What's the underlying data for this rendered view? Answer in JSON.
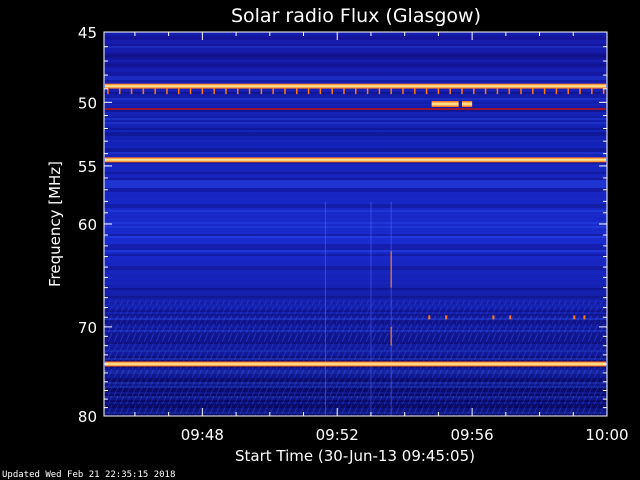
{
  "chart_data": {
    "type": "heatmap",
    "title": "Solar radio Flux (Glasgow)",
    "xlabel": "Start Time (30-Jun-13 09:45:05)",
    "ylabel": "Frequency [MHz]",
    "footer": "Updated Wed Feb 21 22:35:15 2018",
    "x_start_minutes": 45.083,
    "x_end_minutes": 60,
    "x_ticks": [
      {
        "minute": 48,
        "label": "09:48"
      },
      {
        "minute": 52,
        "label": "09:52"
      },
      {
        "minute": 56,
        "label": "09:56"
      },
      {
        "minute": 60,
        "label": "10:00"
      }
    ],
    "y_scale": "log",
    "y_range_mhz": [
      45,
      80
    ],
    "y_ticks": [
      {
        "mhz": 45,
        "label": "45"
      },
      {
        "mhz": 50,
        "label": "50"
      },
      {
        "mhz": 55,
        "label": "55"
      },
      {
        "mhz": 60,
        "label": "60"
      },
      {
        "mhz": 70,
        "label": "70"
      },
      {
        "mhz": 80,
        "label": "80"
      }
    ],
    "bright_bands_mhz": [
      {
        "mhz": 48.8,
        "level": "high"
      },
      {
        "mhz": 54.5,
        "level": "high"
      },
      {
        "mhz": 74.0,
        "level": "high"
      }
    ],
    "colors": {
      "background": "#000000",
      "plot_low": "#0a0a6e",
      "plot_mid": "#1a2bd0",
      "band_hot": "#fff080",
      "band_warm": "#ff8020",
      "band_red": "#d01010",
      "axis": "#ffffff"
    }
  }
}
